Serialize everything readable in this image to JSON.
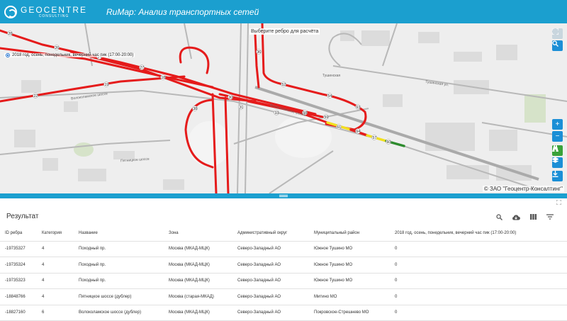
{
  "header": {
    "logo_main": "GEOCENTRE",
    "logo_sub": "CONSULTING",
    "app_title": "RuMap: Анализ транспортных сетей"
  },
  "map": {
    "hint": "Выберите ребро для расчёта",
    "layer_label": "2018 год, осень, понедельник, вечерний час пик (17:00-20:00)",
    "copyright": "© ЗАО \"Геоцентр-Консалтинг\"",
    "labels": {
      "road_volokolamskoe_1": "Волоколамское шоссе",
      "road_volokolamskoe_2": "Волоколамское шоссе",
      "metro": "Тушинская",
      "street_1": "Тушинская ул.",
      "street_2": "Пятницкое шоссе"
    },
    "edge_values": [
      "28",
      "26",
      "24",
      "27",
      "22",
      "19",
      "18",
      "36",
      "52",
      "54",
      "63",
      "61",
      "64",
      "57",
      "60",
      "59",
      "58",
      "38",
      "30",
      "31",
      "33"
    ],
    "controls": {
      "fullscreen_icon": "fullscreen-icon",
      "search_icon": "search-icon",
      "zoom_in_label": "+",
      "zoom_out_label": "−",
      "route_icon": "road-icon",
      "layers_icon": "layers-icon",
      "download_icon": "download-icon"
    },
    "colors": {
      "congested": "#e51b1b",
      "medium": "#f2e01e",
      "free": "#2e8b2e",
      "accent": "#1b9fcf"
    }
  },
  "results": {
    "title": "Результат",
    "toolbar_icons": [
      "search-icon",
      "cloud-download-icon",
      "columns-icon",
      "filter-icon"
    ],
    "columns": [
      "ID ребра",
      "Категория",
      "Название",
      "Зона",
      "Административный округ",
      "Муниципальный район",
      "2018 год, осень, понедельник, вечерний час пик (17:00-20:00)"
    ],
    "rows": [
      [
        "-19735327",
        "4",
        "Походный пр.",
        "Москва (МКАД-МЦК)",
        "Северо-Западный АО",
        "Южное Тушино МО",
        "0"
      ],
      [
        "-19735324",
        "4",
        "Походный пр.",
        "Москва (МКАД-МЦК)",
        "Северо-Западный АО",
        "Южное Тушино МО",
        "0"
      ],
      [
        "-19735323",
        "4",
        "Походный пр.",
        "Москва (МКАД-МЦК)",
        "Северо-Западный АО",
        "Южное Тушино МО",
        "0"
      ],
      [
        "-18848766",
        "4",
        "Пятницкое шоссе (дублер)",
        "Москва (старая-МКАД)",
        "Северо-Западный АО",
        "Митино МО",
        "0"
      ],
      [
        "-18827160",
        "6",
        "Волоколамское шоссе (дублер)",
        "Москва (МКАД-МЦК)",
        "Северо-Западный АО",
        "Покровское-Стрешнево МО",
        "0"
      ]
    ]
  }
}
